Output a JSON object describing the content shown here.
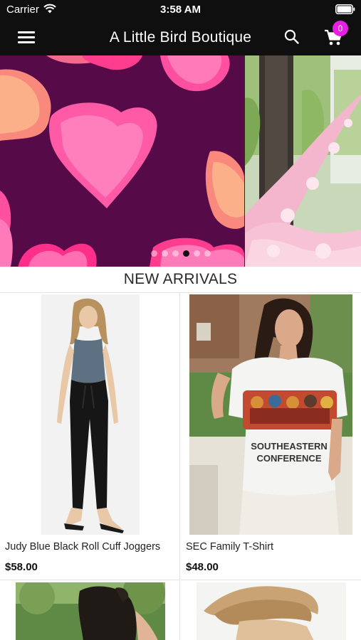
{
  "status_bar": {
    "carrier": "Carrier",
    "time": "3:58 AM"
  },
  "nav": {
    "title": "A Little Bird Boutique",
    "cart_count": "0",
    "accent_color": "#e91ee4",
    "bar_color": "#0f0f0f"
  },
  "carousel": {
    "slide_count": 6,
    "active_index": 3
  },
  "section": {
    "title": "NEW ARRIVALS"
  },
  "products": [
    {
      "name": "Judy Blue Black Roll Cuff Joggers",
      "price": "$58.00"
    },
    {
      "name": "SEC Family T-Shirt",
      "price": "$48.00"
    }
  ]
}
